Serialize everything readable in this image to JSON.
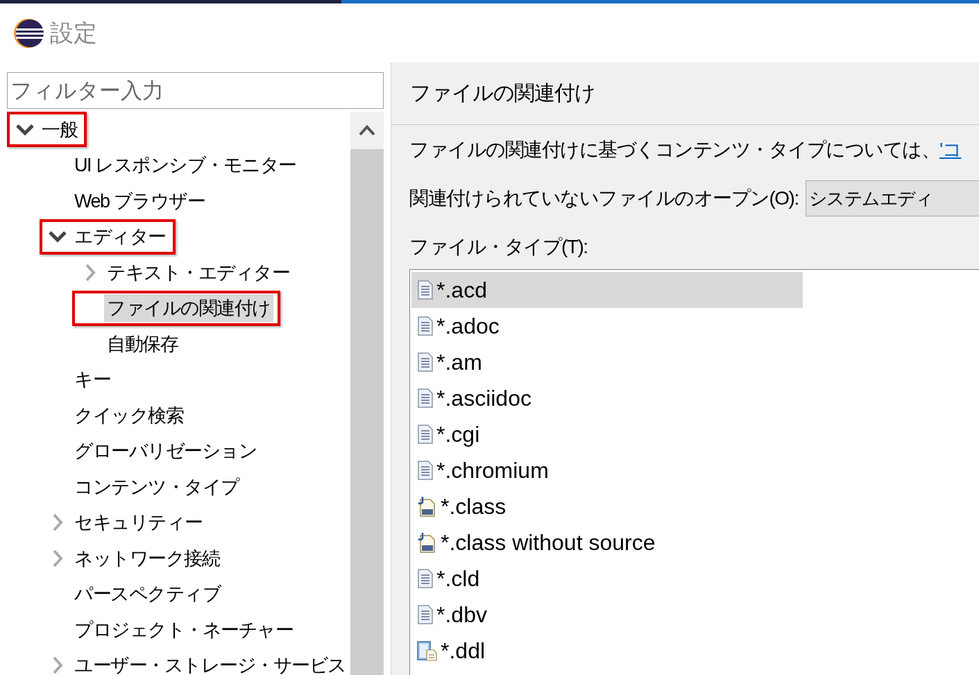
{
  "window": {
    "title": "設定"
  },
  "filter": {
    "placeholder": "フィルター入力"
  },
  "tree": [
    {
      "label": "一般",
      "expanded": true,
      "selected": false,
      "highlighted": true,
      "children": [
        {
          "label": "UI レスポンシブ・モニター",
          "selected": false,
          "highlighted": false
        },
        {
          "label": "Web ブラウザー",
          "selected": false,
          "highlighted": false
        },
        {
          "label": "エディター",
          "expanded": true,
          "selected": false,
          "highlighted": true,
          "children": [
            {
              "label": "テキスト・エディター",
              "expanded": false,
              "selected": false,
              "highlighted": false
            },
            {
              "label": "ファイルの関連付け",
              "selected": true,
              "highlighted": true
            },
            {
              "label": "自動保存",
              "selected": false,
              "highlighted": false
            }
          ]
        },
        {
          "label": "キー",
          "selected": false,
          "highlighted": false
        },
        {
          "label": "クイック検索",
          "selected": false,
          "highlighted": false
        },
        {
          "label": "グローバリゼーション",
          "selected": false,
          "highlighted": false
        },
        {
          "label": "コンテンツ・タイプ",
          "selected": false,
          "highlighted": false
        },
        {
          "label": "セキュリティー",
          "expanded": false,
          "selected": false,
          "highlighted": false
        },
        {
          "label": "ネットワーク接続",
          "expanded": false,
          "selected": false,
          "highlighted": false
        },
        {
          "label": "パースペクティブ",
          "selected": false,
          "highlighted": false
        },
        {
          "label": "プロジェクト・ネーチャー",
          "selected": false,
          "highlighted": false
        },
        {
          "label": "ユーザー・ストレージ・サービス",
          "expanded": false,
          "selected": false,
          "highlighted": false
        }
      ]
    }
  ],
  "panel": {
    "title": "ファイルの関連付け",
    "description": "ファイルの関連付けに基づくコンテンツ・タイプについては、",
    "link": "'コ",
    "open_label": "関連付けられていないファイルのオープン(O):",
    "open_value": "システムエディ",
    "file_types_label": "ファイル・タイプ(T):",
    "file_types": [
      {
        "name": "*.acd",
        "kind": "text",
        "selected": true
      },
      {
        "name": "*.adoc",
        "kind": "text",
        "selected": false
      },
      {
        "name": "*.am",
        "kind": "text",
        "selected": false
      },
      {
        "name": "*.asciidoc",
        "kind": "text",
        "selected": false
      },
      {
        "name": "*.cgi",
        "kind": "text",
        "selected": false
      },
      {
        "name": "*.chromium",
        "kind": "text",
        "selected": false
      },
      {
        "name": "*.class",
        "kind": "class",
        "selected": false
      },
      {
        "name": "*.class without source",
        "kind": "class",
        "selected": false
      },
      {
        "name": "*.cld",
        "kind": "text",
        "selected": false
      },
      {
        "name": "*.dbv",
        "kind": "text",
        "selected": false
      },
      {
        "name": "*.ddl",
        "kind": "ddl",
        "selected": false
      }
    ]
  }
}
